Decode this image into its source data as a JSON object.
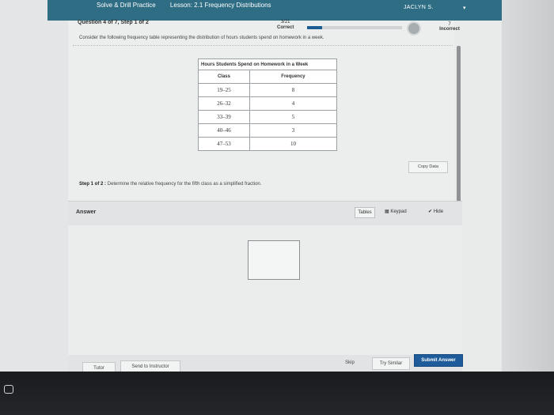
{
  "header": {
    "crumb": "Solve & Drill Practice",
    "lesson": "Lesson: 2.1 Frequency Distributions",
    "user": "JACLYN S."
  },
  "question": {
    "label": "Question 4 of 7,  Step 1 of 2",
    "progress_count": "3/21",
    "progress_status": "Correct",
    "progress_fraction": 0.16,
    "score": "7",
    "score_status": "Incorrect",
    "prompt": "Consider the following frequency table representing the distribution of hours students spend on homework in a week."
  },
  "table": {
    "caption": "Hours Students Spend on Homework in a Week",
    "headers": [
      "Class",
      "Frequency"
    ],
    "rows": [
      [
        "19–25",
        "8"
      ],
      [
        "26–32",
        "4"
      ],
      [
        "33–39",
        "5"
      ],
      [
        "40–46",
        "3"
      ],
      [
        "47–53",
        "10"
      ]
    ]
  },
  "copy_data": "Copy Data",
  "step": {
    "label": "Step 1 of 2 :",
    "text": " Determine the relative frequency for the fifth class as a simplified fraction."
  },
  "answer": {
    "label": "Answer",
    "tables": "Tables",
    "keypad": "Keypad",
    "hide": "Hide"
  },
  "footer": {
    "tutor": "Tutor",
    "send": "Send to Instructor",
    "skip": "Skip",
    "similar": "Try Similar",
    "submit": "Submit Answer"
  },
  "colors": {
    "topbar": "#2e6d83",
    "submit": "#1d5b9a"
  }
}
